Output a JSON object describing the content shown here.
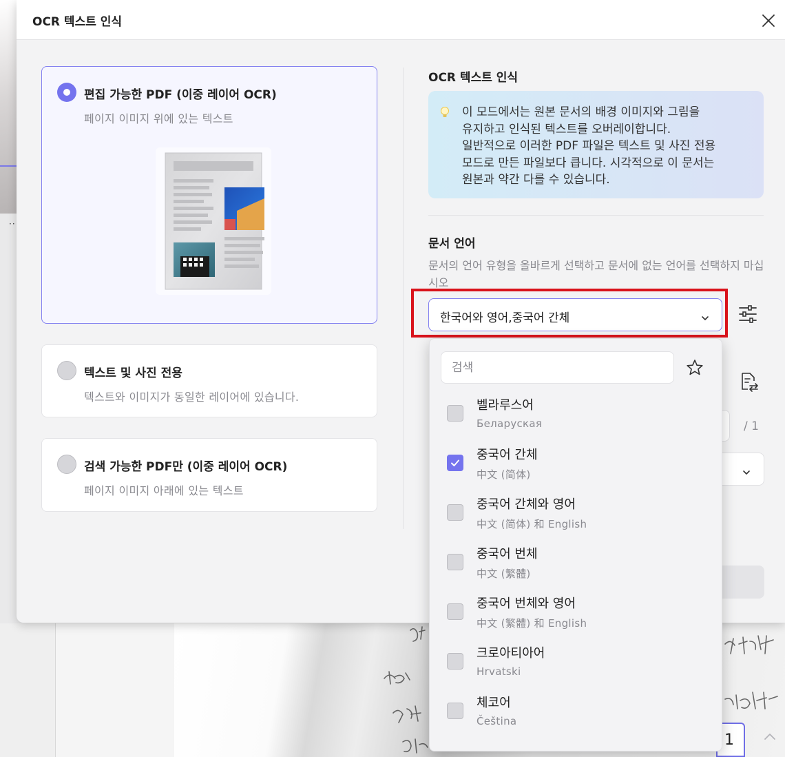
{
  "dialog": {
    "title": "OCR 텍스트 인식"
  },
  "modes": [
    {
      "title": "편집 가능한 PDF (이중 레이어 OCR)",
      "description": "페이지 이미지 위에 있는 텍스트",
      "selected": true
    },
    {
      "title": "텍스트 및 사진 전용",
      "description": "텍스트와 이미지가 동일한 레이어에 있습니다.",
      "selected": false
    },
    {
      "title": "검색 가능한 PDF만 (이중 레이어 OCR)",
      "description": "페이지 이미지 아래에 있는 텍스트",
      "selected": false
    }
  ],
  "right_panel": {
    "title": "OCR 텍스트 인식",
    "info_lines": [
      "이 모드에서는 원본 문서의 배경 이미지와 그림을",
      "유지하고 인식된 텍스트를 오버레이합니다.",
      "일반적으로 이러한 PDF 파일은 텍스트 및 사진 전용",
      "모드로 만든 파일보다 큽니다. 시각적으로 이 문서는",
      "원본과 약간 다를 수 있습니다."
    ],
    "language_section_title": "문서 언어",
    "language_hint": "문서의 언어 유형을 올바르게 선택하고 문서에 없는 언어를 선택하지 마십시오",
    "selected_languages": "한국어와 영어,중국어 간체",
    "page_total": "/ 1"
  },
  "language_dropdown": {
    "search_placeholder": "검색",
    "items": [
      {
        "name": "벨라루스어",
        "native": "Беларуская",
        "checked": false
      },
      {
        "name": "중국어 간체",
        "native": "中文 (简体)",
        "checked": true
      },
      {
        "name": "중국어 간체와 영어",
        "native": "中文 (简体) 和 English",
        "checked": false
      },
      {
        "name": "중국어 번체",
        "native": "中文 (繁體)",
        "checked": false
      },
      {
        "name": "중국어 번체와 영어",
        "native": "中文 (繁體) 和 English",
        "checked": false
      },
      {
        "name": "크로아티아어",
        "native": "Hrvatski",
        "checked": false
      },
      {
        "name": "체코어",
        "native": "Čeština",
        "checked": false
      }
    ]
  },
  "background": {
    "page_number": "1"
  },
  "colors": {
    "accent": "#7473ee",
    "highlight_frame": "#d9131b",
    "info_box_start": "#d3ecf7",
    "info_box_end": "#dbe1f6"
  },
  "icons": [
    "close-icon",
    "radio-icon",
    "lightbulb-icon",
    "chevron-down-icon",
    "settings-sliders-icon",
    "star-icon",
    "checkbox-icon",
    "document-convert-icon",
    "chevron-up-icon"
  ]
}
